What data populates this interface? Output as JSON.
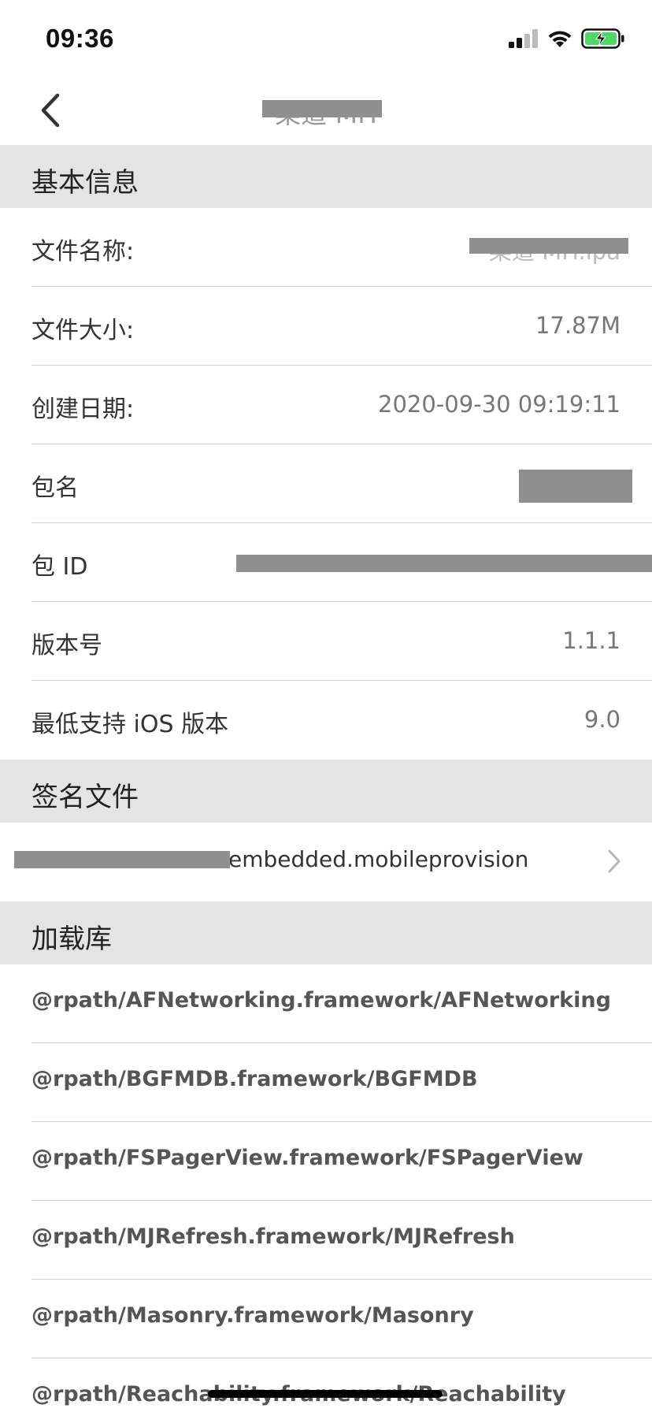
{
  "status_bar": {
    "time": "09:36"
  },
  "nav": {
    "title": "渠道 MH"
  },
  "sections": {
    "basic": {
      "title": "基本信息",
      "rows": [
        {
          "label": "文件名称:",
          "value": "渠道 MH.ipa"
        },
        {
          "label": "文件大小:",
          "value": "17.87M"
        },
        {
          "label": "创建日期:",
          "value": "2020-09-30 09:19:11"
        },
        {
          "label": "包名",
          "value": ""
        },
        {
          "label": "包 ID",
          "value": ""
        },
        {
          "label": "版本号",
          "value": "1.1.1"
        },
        {
          "label": "最低支持 iOS 版本",
          "value": "9.0"
        }
      ]
    },
    "signature": {
      "title": "签名文件",
      "file": "embedded.mobileprovision"
    },
    "libraries": {
      "title": "加载库",
      "items": [
        "@rpath/AFNetworking.framework/AFNetworking",
        "@rpath/BGFMDB.framework/BGFMDB",
        "@rpath/FSPagerView.framework/FSPagerView",
        "@rpath/MJRefresh.framework/MJRefresh",
        "@rpath/Masonry.framework/Masonry",
        "@rpath/Reachability.framework/Reachability"
      ]
    }
  },
  "icons": {
    "back": "chevron-left-icon",
    "cellular": "cellular-signal-icon",
    "wifi": "wifi-icon",
    "battery": "battery-charging-icon",
    "disclosure": "chevron-right-icon"
  },
  "colors": {
    "section_bg": "#e4e4e4",
    "battery_green": "#4cd964",
    "redaction": "#8f8f8f"
  }
}
